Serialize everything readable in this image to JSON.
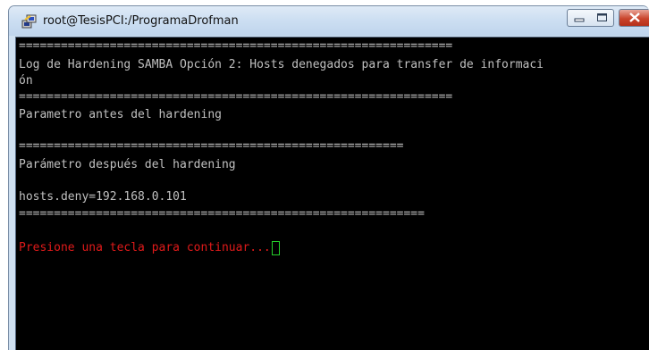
{
  "window": {
    "title": "root@TesisPCI:/ProgramaDrofman",
    "icons": {
      "app": "putty-icon",
      "minimize": "minimize-icon",
      "maximize": "maximize-icon",
      "close": "close-icon"
    }
  },
  "terminal": {
    "separator_1": "==============================================================",
    "header_line_1": "Log de Hardening SAMBA Opción 2: Hosts denegados para transfer de informaci",
    "header_line_2": "ón",
    "separator_2": "==============================================================",
    "before_label": "Parametro antes del hardening",
    "separator_3": "=======================================================",
    "after_label": "Parámetro después del hardening",
    "config_value": "hosts.deny=192.168.0.101",
    "separator_4": "==========================================================",
    "prompt": "Presione una tecla para continuar...",
    "colors": {
      "background": "#000000",
      "text": "#c0c0c0",
      "prompt": "#e01a1a",
      "cursor": "#25d02b"
    }
  }
}
